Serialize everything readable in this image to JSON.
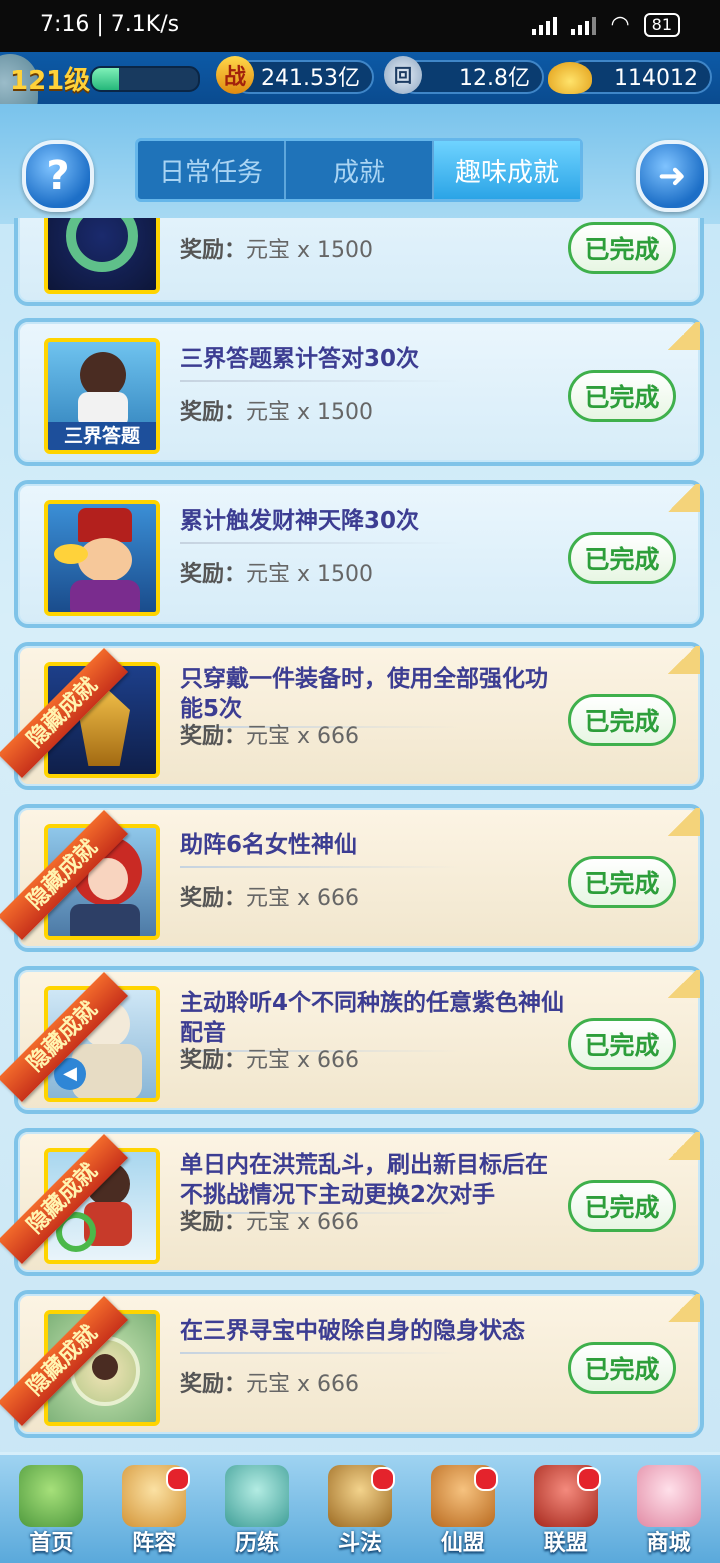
{
  "status_bar": {
    "time": "7:16 | 7.1K/s",
    "battery": "81"
  },
  "player": {
    "level": "121级",
    "exp_fraction": 0.25
  },
  "resources": [
    {
      "name": "power",
      "icon": "battle-power-icon",
      "icon_char": "战",
      "value": "241.53亿"
    },
    {
      "name": "coins",
      "icon": "coin-icon",
      "icon_char": "回",
      "value": "12.8亿"
    },
    {
      "name": "ingots",
      "icon": "gold-ingot-icon",
      "icon_char": "",
      "value": "114012"
    }
  ],
  "header": {
    "help_label": "?",
    "tabs": [
      {
        "label": "日常任务",
        "active": false
      },
      {
        "label": "成就",
        "active": false
      },
      {
        "label": "趣味成就",
        "active": true
      }
    ]
  },
  "tasks": [
    {
      "title": "",
      "reward_label": "奖励：",
      "reward": "元宝 x 1500",
      "status": "已完成",
      "hidden": false,
      "thumb": "swirl-jade-thumb"
    },
    {
      "title": "三界答题累计答对30次",
      "reward_label": "奖励：",
      "reward": "元宝 x 1500",
      "status": "已完成",
      "hidden": false,
      "thumb": "quiz-girl-thumb",
      "thumb_text": "三界答题"
    },
    {
      "title": "累计触发财神天降30次",
      "reward_label": "奖励：",
      "reward": "元宝 x 1500",
      "status": "已完成",
      "hidden": false,
      "thumb": "god-of-wealth-thumb"
    },
    {
      "title": "只穿戴一件装备时，使用全部强化功能5次",
      "reward_label": "奖励：",
      "reward": "元宝 x 666",
      "status": "已完成",
      "hidden": true,
      "ribbon": "隐藏成就",
      "thumb": "armor-warrior-thumb"
    },
    {
      "title": "助阵6名女性神仙",
      "reward_label": "奖励：",
      "reward": "元宝 x 666",
      "status": "已完成",
      "hidden": true,
      "ribbon": "隐藏成就",
      "thumb": "red-hair-goddess-thumb"
    },
    {
      "title": "主动聆听4个不同种族的任意紫色神仙配音",
      "reward_label": "奖励：",
      "reward": "元宝 x 666",
      "status": "已完成",
      "hidden": true,
      "ribbon": "隐藏成就",
      "thumb": "sage-voice-thumb"
    },
    {
      "title": "单日内在洪荒乱斗，刷出新目标后在不挑战情况下主动更换2次对手",
      "reward_label": "奖励：",
      "reward": "元宝 x 666",
      "status": "已完成",
      "hidden": true,
      "ribbon": "隐藏成就",
      "thumb": "refresh-girl-thumb"
    },
    {
      "title": "在三界寻宝中破除自身的隐身状态",
      "reward_label": "奖励：",
      "reward": "元宝 x 666",
      "status": "已完成",
      "hidden": true,
      "ribbon": "隐藏成就",
      "thumb": "treasure-map-thumb"
    }
  ],
  "bottom_nav": [
    {
      "label": "首页",
      "icon": "home-island-icon",
      "badge": false,
      "color": "#7cc86a"
    },
    {
      "label": "阵容",
      "icon": "lineup-icon",
      "badge": true,
      "color": "#f1c06b"
    },
    {
      "label": "历练",
      "icon": "training-vase-icon",
      "badge": false,
      "color": "#77c7c3"
    },
    {
      "label": "斗法",
      "icon": "battle-sword-icon",
      "badge": true,
      "color": "#d9a34a"
    },
    {
      "label": "仙盟",
      "icon": "palace-icon",
      "badge": true,
      "color": "#e49b46"
    },
    {
      "label": "联盟",
      "icon": "alliance-lantern-icon",
      "badge": true,
      "color": "#d64c3e"
    },
    {
      "label": "商城",
      "icon": "shop-fox-girl-icon",
      "badge": false,
      "color": "#f2b3c6"
    }
  ]
}
